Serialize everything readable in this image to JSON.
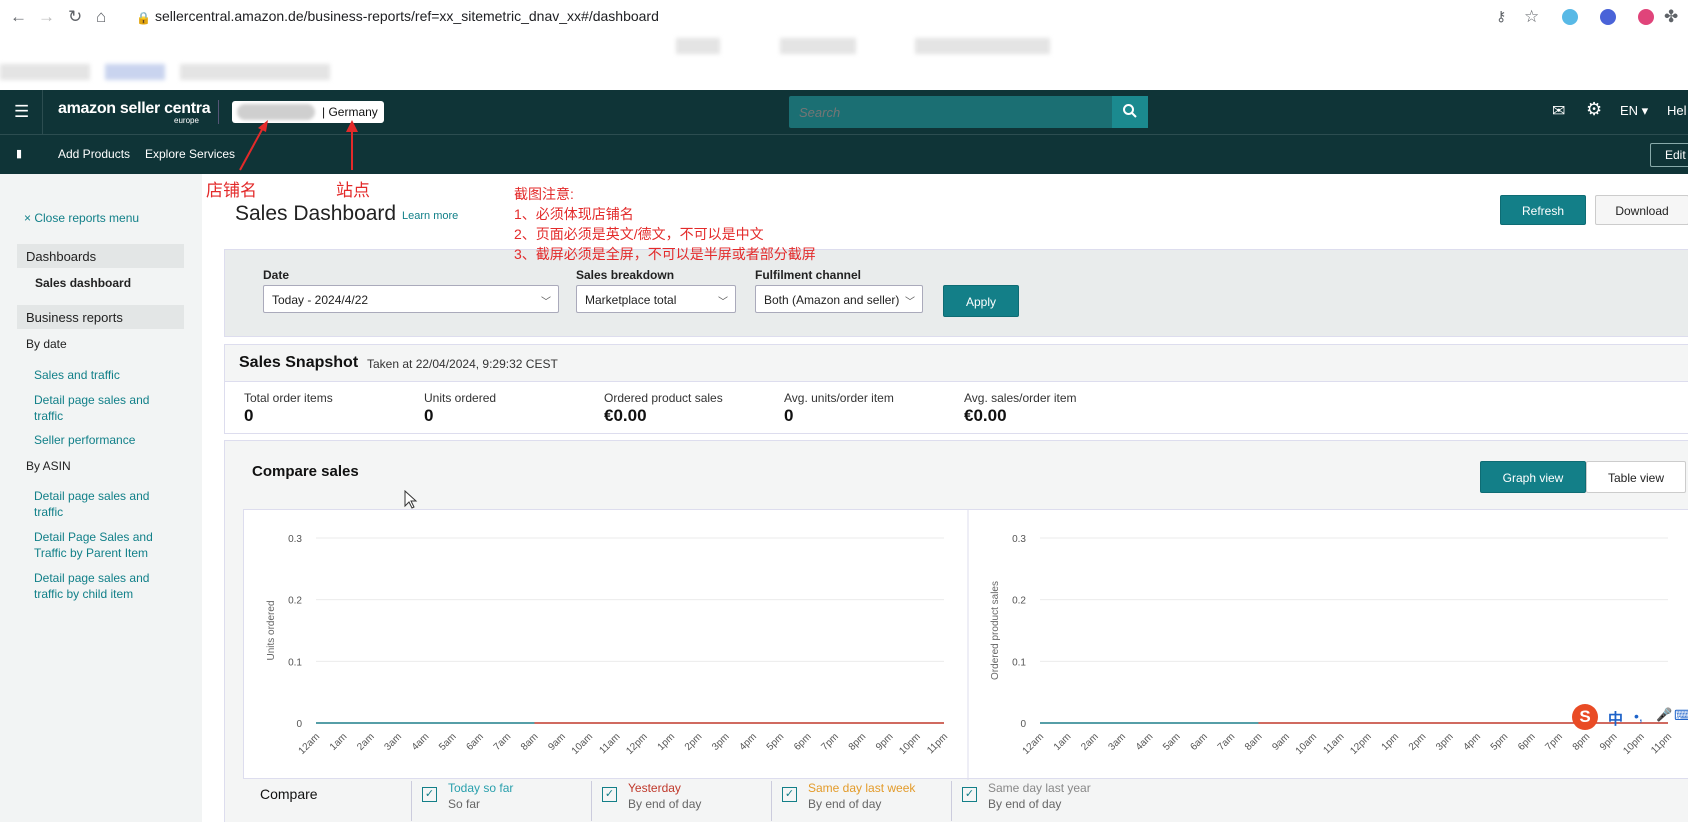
{
  "browser": {
    "url": "sellercentral.amazon.de/business-reports/ref=xx_sitemetric_dnav_xx#/dashboard"
  },
  "header": {
    "logo_text": "amazon seller centra",
    "logo_sub": "europe",
    "store_suffix": "| Germany",
    "search_placeholder": "Search",
    "language": "EN",
    "help": "Hel"
  },
  "subnav": {
    "items": [
      "Add Products",
      "Explore Services"
    ],
    "edit": "Edit"
  },
  "annotations": {
    "store_name": "店铺名",
    "site": "站点",
    "note_title": "截图注意:",
    "note_lines": [
      "1、必须体现店铺名",
      "2、页面必须是英文/德文，不可以是中文",
      "3、截屏必须是全屏，不可以是半屏或者部分截屏"
    ]
  },
  "sidebar": {
    "close": "Close reports menu",
    "dashboards": "Dashboards",
    "sales_dashboard": "Sales dashboard",
    "business_reports": "Business reports",
    "by_date": "By date",
    "by_date_links": [
      "Sales and traffic",
      "Detail page sales and traffic",
      "Seller performance"
    ],
    "by_asin": "By ASIN",
    "by_asin_links": [
      "Detail page sales and traffic",
      "Detail Page Sales and Traffic by Parent Item",
      "Detail page sales and traffic by child item"
    ]
  },
  "main": {
    "title": "Sales Dashboard",
    "learn_more": "Learn more",
    "refresh": "Refresh",
    "download": "Download",
    "filters": {
      "date_label": "Date",
      "date_value": "Today - 2024/4/22",
      "breakdown_label": "Sales breakdown",
      "breakdown_value": "Marketplace total",
      "channel_label": "Fulfilment channel",
      "channel_value": "Both (Amazon and seller)",
      "apply": "Apply"
    },
    "snapshot": {
      "title": "Sales Snapshot",
      "taken": "Taken at 22/04/2024, 9:29:32 CEST",
      "metrics": [
        {
          "label": "Total order items",
          "value": "0"
        },
        {
          "label": "Units ordered",
          "value": "0"
        },
        {
          "label": "Ordered product sales",
          "value": "€0.00"
        },
        {
          "label": "Avg. units/order item",
          "value": "0"
        },
        {
          "label": "Avg. sales/order item",
          "value": "€0.00"
        }
      ]
    },
    "compare": {
      "title": "Compare sales",
      "graph_view": "Graph view",
      "table_view": "Table view",
      "compare_label": "Compare",
      "legend": [
        {
          "name": "Today so far",
          "sub": "So far",
          "color": "#29a0ad"
        },
        {
          "name": "Yesterday",
          "sub": "By end of day",
          "color": "#c0392b"
        },
        {
          "name": "Same day last week",
          "sub": "By end of day",
          "color": "#e39b2a"
        },
        {
          "name": "Same day last year",
          "sub": "By end of day",
          "color": "#888888"
        }
      ]
    }
  },
  "chart_data": [
    {
      "type": "line",
      "ylabel": "Units ordered",
      "ylim": [
        0,
        0.3
      ],
      "yticks": [
        "0.3",
        "0.2",
        "0.1",
        "0"
      ],
      "categories": [
        "12am",
        "1am",
        "2am",
        "3am",
        "4am",
        "5am",
        "6am",
        "7am",
        "8am",
        "9am",
        "10am",
        "11am",
        "12pm",
        "1pm",
        "2pm",
        "3pm",
        "4pm",
        "5pm",
        "6pm",
        "7pm",
        "8pm",
        "9pm",
        "10pm",
        "11pm"
      ],
      "series": [
        {
          "name": "Today so far",
          "values": [
            0,
            0,
            0,
            0,
            0,
            0,
            0,
            0,
            0
          ]
        },
        {
          "name": "Yesterday",
          "values": [
            0,
            0,
            0,
            0,
            0,
            0,
            0,
            0,
            0,
            0,
            0,
            0,
            0,
            0,
            0,
            0,
            0,
            0,
            0,
            0,
            0,
            0,
            0,
            0
          ]
        }
      ]
    },
    {
      "type": "line",
      "ylabel": "Ordered product sales",
      "ylim": [
        0,
        0.3
      ],
      "yticks": [
        "0.3",
        "0.2",
        "0.1",
        "0"
      ],
      "categories": [
        "12am",
        "1am",
        "2am",
        "3am",
        "4am",
        "5am",
        "6am",
        "7am",
        "8am",
        "9am",
        "10am",
        "11am",
        "12pm",
        "1pm",
        "2pm",
        "3pm",
        "4pm",
        "5pm",
        "6pm",
        "7pm",
        "8pm",
        "9pm",
        "10pm",
        "11pm"
      ],
      "series": [
        {
          "name": "Today so far",
          "values": [
            0,
            0,
            0,
            0,
            0,
            0,
            0,
            0,
            0
          ]
        },
        {
          "name": "Yesterday",
          "values": [
            0,
            0,
            0,
            0,
            0,
            0,
            0,
            0,
            0,
            0,
            0,
            0,
            0,
            0,
            0,
            0,
            0,
            0,
            0,
            0,
            0,
            0,
            0,
            0
          ]
        }
      ]
    }
  ],
  "ime": {
    "logo": "S",
    "cn": "中",
    "punct": "•,",
    "mic": "🎤",
    "kb": "⌨"
  }
}
